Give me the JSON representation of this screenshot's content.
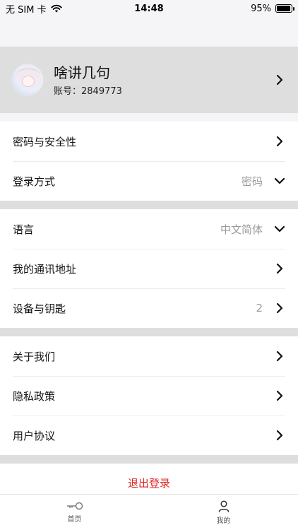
{
  "status_bar": {
    "carrier": "无 SIM 卡",
    "time": "14:48",
    "battery": "95%",
    "battery_level": 0.95,
    "icons": [
      "wifi-icon",
      "battery-icon"
    ]
  },
  "profile": {
    "name": "啥讲几句",
    "account": "账号：2849773"
  },
  "section1": {
    "items": [
      {
        "label": "密码与安全性",
        "value": "",
        "icon": "chevron-right-icon"
      },
      {
        "label": "登录方式",
        "value": "密码",
        "icon": "chevron-down-icon"
      }
    ]
  },
  "section2": {
    "items": [
      {
        "label": "语言",
        "value": "中文简体",
        "icon": "chevron-down-icon"
      },
      {
        "label": "我的通讯地址",
        "value": "",
        "icon": "chevron-right-icon"
      },
      {
        "label": "设备与钥匙",
        "value": "2",
        "icon": "chevron-right-icon"
      }
    ]
  },
  "section3": {
    "items": [
      {
        "label": "关于我们",
        "value": "",
        "icon": "chevron-right-icon"
      },
      {
        "label": "隐私政策",
        "value": "",
        "icon": "chevron-right-icon"
      },
      {
        "label": "用户协议",
        "value": "",
        "icon": "chevron-right-icon"
      }
    ]
  },
  "logout_label": "退出登录",
  "colors": {
    "accent_red": "#e02424",
    "section_gap": "#dedede"
  },
  "tabbar": {
    "tabs": [
      {
        "label": "首页",
        "icon": "key-icon"
      },
      {
        "label": "我的",
        "icon": "user-icon"
      }
    ]
  }
}
